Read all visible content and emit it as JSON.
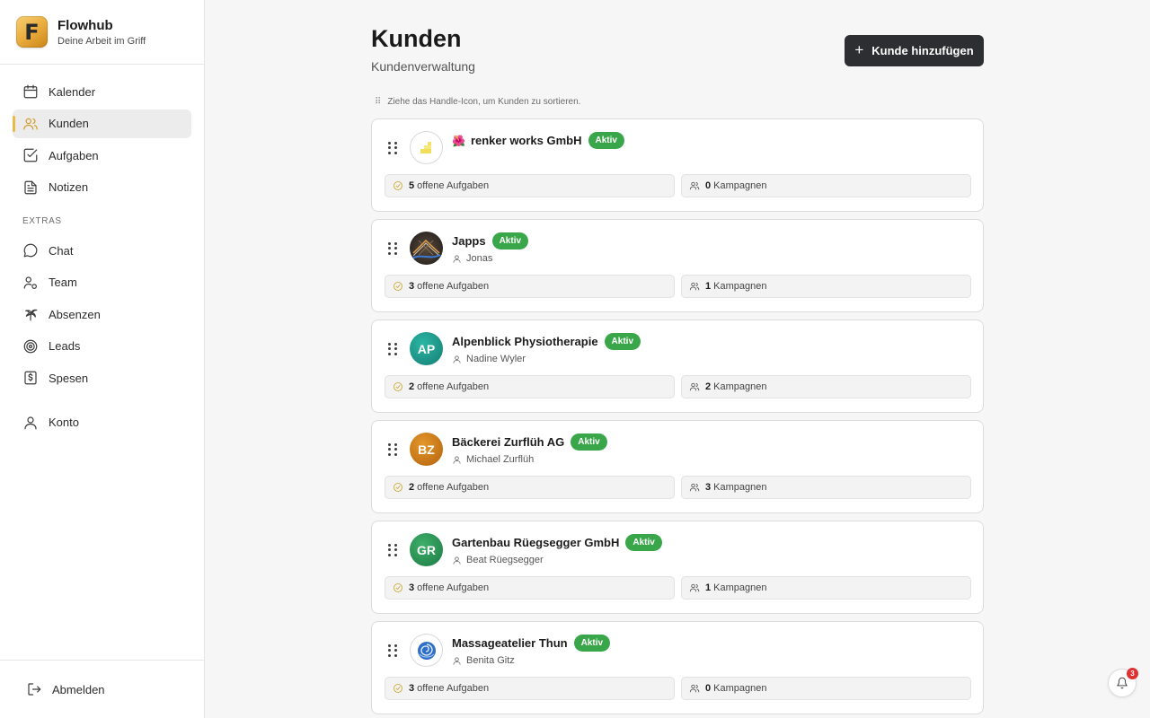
{
  "app": {
    "name": "Flowhub",
    "tagline": "Deine Arbeit im Griff",
    "logo_letter": "F"
  },
  "sidebar": {
    "main_items": [
      {
        "label": "Kalender",
        "icon": "calendar-icon",
        "active": false
      },
      {
        "label": "Kunden",
        "icon": "users-icon",
        "active": true
      },
      {
        "label": "Aufgaben",
        "icon": "checkbox-icon",
        "active": false
      },
      {
        "label": "Notizen",
        "icon": "note-icon",
        "active": false
      }
    ],
    "extras_label": "EXTRAS",
    "extras_items": [
      {
        "label": "Chat",
        "icon": "chat-icon"
      },
      {
        "label": "Team",
        "icon": "team-icon"
      },
      {
        "label": "Absenzen",
        "icon": "palm-tree-icon"
      },
      {
        "label": "Leads",
        "icon": "target-icon"
      },
      {
        "label": "Spesen",
        "icon": "dollar-receipt-icon"
      }
    ],
    "account_label": "Konto",
    "logout_label": "Abmelden"
  },
  "header": {
    "title": "Kunden",
    "subtitle": "Kundenverwaltung",
    "add_button_label": "Kunde hinzufügen",
    "sort_hint": "Ziehe das Handle-Icon, um Kunden zu sortieren."
  },
  "colors": {
    "accent": "#e9b949",
    "badge_green": "#3aa64a",
    "button_dark": "#2d2e31",
    "notification_red": "#e03131"
  },
  "customers": [
    {
      "name": "renker works GmbH",
      "emoji": "🌺",
      "status": "Aktiv",
      "contact": "",
      "avatar_initials": "",
      "avatar_type": "logo-yellow",
      "open_tasks": "5",
      "tasks_label": "offene Aufgaben",
      "campaigns": "0",
      "campaigns_label": "Kampagnen"
    },
    {
      "name": "Japps",
      "emoji": "",
      "status": "Aktiv",
      "contact": "Jonas",
      "avatar_initials": "",
      "avatar_type": "logo-dark",
      "open_tasks": "3",
      "tasks_label": "offene Aufgaben",
      "campaigns": "1",
      "campaigns_label": "Kampagnen"
    },
    {
      "name": "Alpenblick Physiotherapie",
      "emoji": "",
      "status": "Aktiv",
      "contact": "Nadine Wyler",
      "avatar_initials": "AP",
      "avatar_type": "teal",
      "open_tasks": "2",
      "tasks_label": "offene Aufgaben",
      "campaigns": "2",
      "campaigns_label": "Kampagnen"
    },
    {
      "name": "Bäckerei Zurflüh AG",
      "emoji": "",
      "status": "Aktiv",
      "contact": "Michael Zurflüh",
      "avatar_initials": "BZ",
      "avatar_type": "orange",
      "open_tasks": "2",
      "tasks_label": "offene Aufgaben",
      "campaigns": "3",
      "campaigns_label": "Kampagnen"
    },
    {
      "name": "Gartenbau Rüegsegger GmbH",
      "emoji": "",
      "status": "Aktiv",
      "contact": "Beat Rüegsegger",
      "avatar_initials": "GR",
      "avatar_type": "green",
      "open_tasks": "3",
      "tasks_label": "offene Aufgaben",
      "campaigns": "1",
      "campaigns_label": "Kampagnen"
    },
    {
      "name": "Massageatelier Thun",
      "emoji": "",
      "status": "Aktiv",
      "contact": "Benita Gitz",
      "avatar_initials": "",
      "avatar_type": "logo-rose",
      "open_tasks": "3",
      "tasks_label": "offene Aufgaben",
      "campaigns": "0",
      "campaigns_label": "Kampagnen"
    }
  ],
  "notifications": {
    "count": "3"
  }
}
